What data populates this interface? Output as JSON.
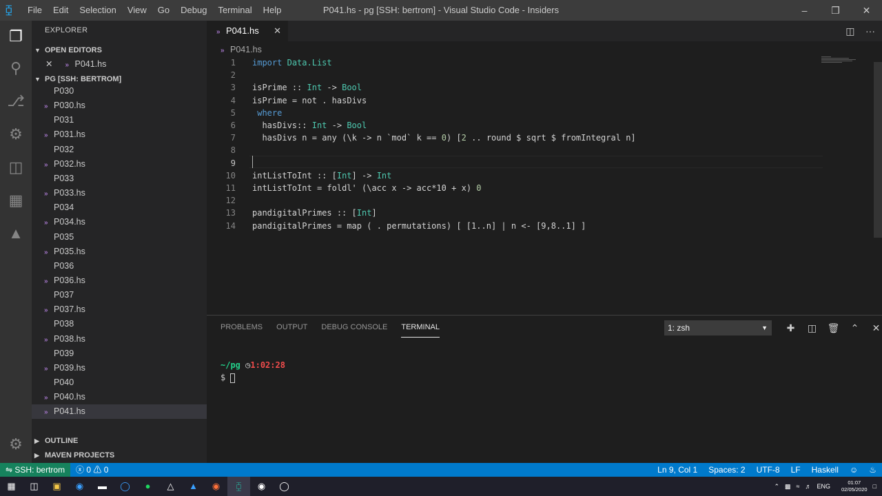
{
  "titlebar": {
    "menu": [
      "File",
      "Edit",
      "Selection",
      "View",
      "Go",
      "Debug",
      "Terminal",
      "Help"
    ],
    "title": "P041.hs - pg [SSH: bertrom] - Visual Studio Code - Insiders",
    "minimize": "–",
    "restore": "❐",
    "close": "✕"
  },
  "sidebar": {
    "title": "EXPLORER",
    "open_editors": "OPEN EDITORS",
    "open_files": [
      "P041.hs"
    ],
    "workspace": "PG [SSH: BERTROM]",
    "files": [
      "P030",
      "P030.hs",
      "P031",
      "P031.hs",
      "P032",
      "P032.hs",
      "P033",
      "P033.hs",
      "P034",
      "P034.hs",
      "P035",
      "P035.hs",
      "P036",
      "P036.hs",
      "P037",
      "P037.hs",
      "P038",
      "P038.hs",
      "P039",
      "P039.hs",
      "P040",
      "P040.hs",
      "P041.hs"
    ],
    "outline": "OUTLINE",
    "maven": "MAVEN PROJECTS"
  },
  "editor": {
    "tab": "P041.hs",
    "breadcrumb": "P041.hs",
    "lines": [
      "import Data.List",
      "",
      "isPrime :: Int -> Bool",
      "isPrime = not . hasDivs",
      " where",
      "  hasDivs:: Int -> Bool",
      "  hasDivs n = any (\\k -> n `mod` k == 0) [2 .. round $ sqrt $ fromIntegral n]",
      "",
      "",
      "intListToInt :: [Int] -> Int",
      "intListToInt = foldl' (\\acc x -> acc*10 + x) 0",
      "",
      "pandigitalPrimes :: [Int]",
      "pandigitalPrimes = map ( . permutations) [ [1..n] | n <- [9,8..1] ]"
    ],
    "current_line": 9
  },
  "panel": {
    "tabs": [
      "PROBLEMS",
      "OUTPUT",
      "DEBUG CONSOLE",
      "TERMINAL"
    ],
    "active_tab": "TERMINAL",
    "terminal_select": "1: zsh",
    "terminal": {
      "path": "~/pg",
      "time": "1:02:28",
      "prompt": "$"
    }
  },
  "statusbar": {
    "remote": "SSH: bertrom",
    "errors": "0",
    "warnings": "0",
    "position": "Ln 9, Col 1",
    "spaces": "Spaces: 2",
    "encoding": "UTF-8",
    "eol": "LF",
    "language": "Haskell"
  },
  "taskbar": {
    "lang": "ENG",
    "time": "01:07",
    "date": "02/05/2020"
  }
}
